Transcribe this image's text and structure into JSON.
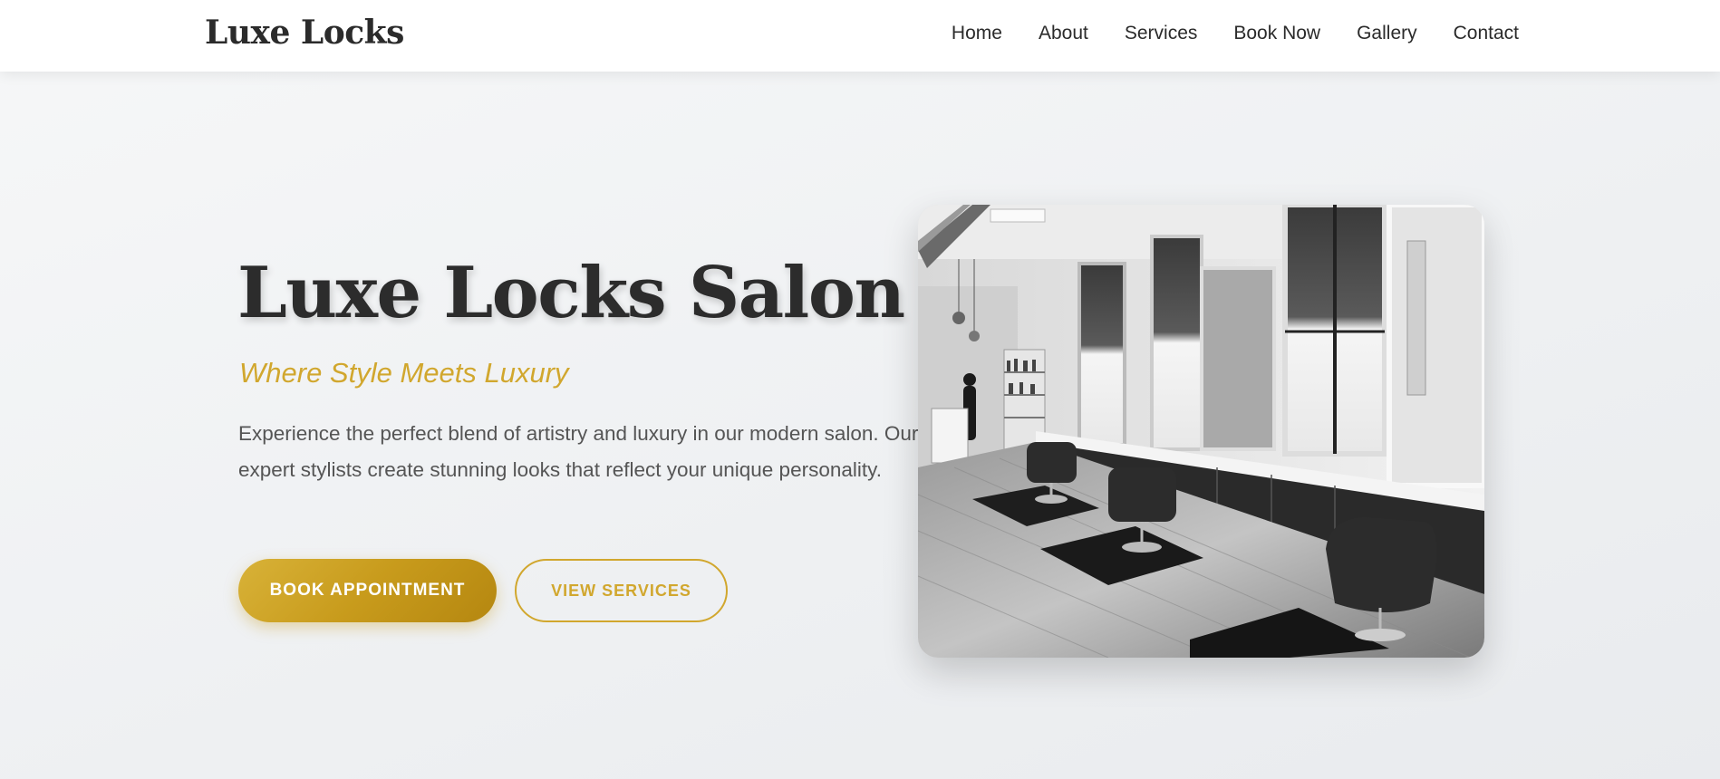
{
  "nav": {
    "brand": "Luxe Locks",
    "links": [
      "Home",
      "About",
      "Services",
      "Book Now",
      "Gallery",
      "Contact"
    ]
  },
  "hero": {
    "title": "Luxe Locks Salon",
    "tagline": "Where Style Meets Luxury",
    "description": "Experience the perfect blend of artistry and luxury in our modern salon. Our expert stylists create stunning looks that reflect your unique personality.",
    "primary_button": "BOOK APPOINTMENT",
    "secondary_button": "VIEW SERVICES"
  },
  "colors": {
    "accent": "#d1a72e",
    "text_dark": "#2c2c2c",
    "text_body": "#555555",
    "background": "#f2f3f5"
  }
}
